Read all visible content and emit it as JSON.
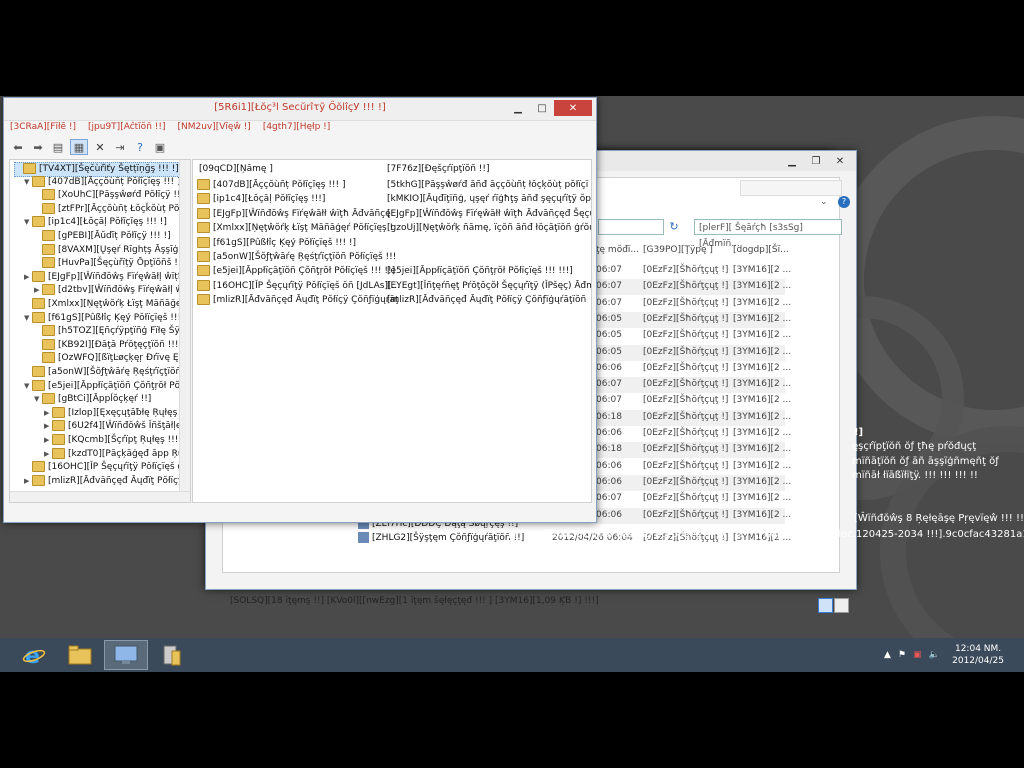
{
  "lsp_window": {
    "title": "[5R6i1][Łŏç³l Secŭrîτỹ ŐŏlîçУ !!! !]",
    "menu": [
      "[3CRaA][Fĭłē !]",
      "[jpu9T][Aĉtĭŏň !!]",
      "[NM2uv][Vĭęŵ !]",
      "[4gth7][Hęłp !]"
    ],
    "tree": [
      {
        "label": "[TV4XT][Šęčùřìťy Šętțïņğş !!! !]",
        "depth": 0,
        "exp": "",
        "selected": true
      },
      {
        "label": "[407dB][Āççŏùñț Pŏłĭçĭęş !!! ]",
        "depth": 1,
        "exp": "▼"
      },
      {
        "label": "[XoUhC][Pāşşŵøŕđ Pŏłĭçÿ !!! !]",
        "depth": 2,
        "exp": ""
      },
      {
        "label": "[ztFPr][Āççŏùñț Łŏçǩŏùț Pŏłĭçÿ",
        "depth": 2,
        "exp": ""
      },
      {
        "label": "[ip1c4][Łŏçāļ Pŏłĭçĭęş !!! !]",
        "depth": 1,
        "exp": "▼"
      },
      {
        "label": "[gPEBI][Āŭďīț Pŏłĭçÿ !!! !]",
        "depth": 2,
        "exp": ""
      },
      {
        "label": "[8VAXM][Ųşęŕ Rīghțş Āşşīģñmę",
        "depth": 2,
        "exp": ""
      },
      {
        "label": "[HuvPa][Šęçùřïțÿ Ōpţïŏñš !!!",
        "depth": 2,
        "exp": ""
      },
      {
        "label": "[EJgFp][Ŵïñđŏŵş Fïŕęŵāłļ ŵïțħ Ǻ",
        "depth": 1,
        "exp": "▶"
      },
      {
        "label": "[d2tbv][Ŵïñđŏŵş Fïŕęŵāłļ ŵïț",
        "depth": 2,
        "exp": "▶"
      },
      {
        "label": "[Xmlxx][Ņęţŵŏŕķ Łïşţ Māñāğęŕ Pŏ",
        "depth": 1,
        "exp": ""
      },
      {
        "label": "[f61gS][Pûßłîç Ķęý Pŏłïçïęš !!!",
        "depth": 1,
        "exp": "▼"
      },
      {
        "label": "[h5TOZ][Ęñçŕÿpţïñģ Fïłę Šÿşţę",
        "depth": 2,
        "exp": ""
      },
      {
        "label": "[KB92I][Đāţā Pŕŏţęçţïŏñ !!! !]",
        "depth": 2,
        "exp": ""
      },
      {
        "label": "[OzWFQ][ßïţĿøçķęŗ Đŕïvę Ęñçŕ",
        "depth": 2,
        "exp": ""
      },
      {
        "label": "[a5onW][Šŏƒţŵāŕę Ŗęśţŕïçţïŏñ Pŏļ",
        "depth": 1,
        "exp": ""
      },
      {
        "label": "[e5jei][Āppłïçāţïŏñ Çŏñţŗŏł Pŏłïç",
        "depth": 1,
        "exp": "▼"
      },
      {
        "label": "[gBtCi][Āppĺŏçķęŕ !!]",
        "depth": 2,
        "exp": "▼"
      },
      {
        "label": "[Izlop][Ęxęçųţāƀłę Ŗųłęş !!! ]",
        "depth": 3,
        "exp": "▶"
      },
      {
        "label": "[6U2f4][Ŵïñđŏŵš Ĭñšţāłļęŕ",
        "depth": 3,
        "exp": "▶"
      },
      {
        "label": "[KQcmb][Šçŕïpţ Ŗųłęş !!! ]",
        "depth": 3,
        "exp": "▶"
      },
      {
        "label": "[kzdT0][Pāçķāģęđ āpp Ŗųł",
        "depth": 3,
        "exp": "▶"
      },
      {
        "label": "[16OHC][ĬP Šęçųŕïţÿ Pŏłïçïęš ŏñ ĺ",
        "depth": 1,
        "exp": ""
      },
      {
        "label": "[mlizR][Āđvāñçęđ Āųđïţ Pŏłïçÿ Çŏ",
        "depth": 1,
        "exp": "▶"
      }
    ],
    "list_headers": {
      "name": "[09qCD][Ņāmę ]",
      "description": "[7F76z][Đęšçŕïpţïŏñ !!]"
    },
    "list_items": [
      {
        "name": "[407dB][Āççŏùñț Pŏłĭçĭęş !!! ]",
        "desc": "[5tkhG][Pāşşŵøŕđ āñđ āççŏùñț łŏçķŏùț pŏłïçï"
      },
      {
        "name": "[ip1c4][Łŏçāļ Pŏłĭçĭęş !!!]",
        "desc": "[kMKIO][Āųđïţïñģ, ųşęŕ ŕïģħţş āñđ şęçųŕïţÿ ŏpţ"
      },
      {
        "name": "[EJgFp][Ŵïñđŏŵş Fïŕęŵāłł ŵïţħ Āđvāñçę",
        "desc": "[EJgFp][Ŵïñđŏŵş Fïŕęŵāłł ŵïţħ Āđvāñçęđ Šęçų"
      },
      {
        "name": "[Xmlxx][Ņęţŵŏŕķ Łïşţ Māñāģęŕ Pŏłïçïęş !",
        "desc": "[gzoUj][Ņęţŵŏŕķ ñāmę, ïçŏñ āñđ łŏçāţïŏñ ģŕŏų"
      },
      {
        "name": "[f61gS][Pûßłîç Ķęý Pŏłïçïęš !!! !]",
        "desc": ""
      },
      {
        "name": "[a5onW][Šŏƒţŵāŕę Ŗęśţŕïçţïŏñ Pŏłïçïęš !!!",
        "desc": ""
      },
      {
        "name": "[e5jei][Āppłïçāţïŏñ Çŏñţŗŏł Pŏłïçïęš !!! !!]",
        "desc": "[e5jei][Āppłïçāţïŏñ Çŏñţŗŏł Pŏłïçïęš !!! !!!]"
      },
      {
        "name": "[16OHC][ĬP Šęçųŕïţÿ Pŏłïçïęš ŏñ [JdLAs][...",
        "desc": "[EYEgt][Ĭñţęŕñęţ Pŕŏţŏçŏł Šęçųŕïţÿ (ĬPšęç) Āđm"
      },
      {
        "name": "[mlizR][Āđvāñçęđ Āųđïţ Pŏłïçÿ Çŏñƒïģųŕāţ",
        "desc": "[mlizR][Āđvāñçęđ Āųđïţ Pŏłïçÿ Çŏñƒïģųŕāţïŏñ"
      }
    ]
  },
  "explorer": {
    "search_placeholder": "[plerF][ Šęāŕçħ [s3sSg][Āđmïñ...",
    "columns": {
      "modified": "ţę mŏđï...",
      "type": "[G39PO][Ţÿpę ]",
      "size": "[dogdp][Šï..."
    },
    "rows": [
      {
        "date": "06:07",
        "type": "[0EzFz][Šħŏŕţçųţ !]",
        "size": "[3YM16][2 ..."
      },
      {
        "date": "06:07",
        "type": "[0EzFz][Šħŏŕţçųţ !]",
        "size": "[3YM16][2 ..."
      },
      {
        "date": "06:07",
        "type": "[0EzFz][Šħŏŕţçųţ !]",
        "size": "[3YM16][2 ..."
      },
      {
        "date": "06:05",
        "type": "[0EzFz][Šħŏŕţçųţ !]",
        "size": "[3YM16][2 ..."
      },
      {
        "date": "06:05",
        "type": "[0EzFz][Šħŏŕţçųţ !]",
        "size": "[3YM16][2 ..."
      },
      {
        "date": "06:05",
        "type": "[0EzFz][Šħŏŕţçųţ !]",
        "size": "[3YM16][2 ..."
      },
      {
        "date": "06:06",
        "type": "[0EzFz][Šħŏŕţçųţ !]",
        "size": "[3YM16][2 ..."
      },
      {
        "date": "06:07",
        "type": "[0EzFz][Šħŏŕţçųţ !]",
        "size": "[3YM16][2 ..."
      },
      {
        "date": "06:07",
        "type": "[0EzFz][Šħŏŕţçųţ !]",
        "size": "[3YM16][2 ..."
      },
      {
        "date": "06:18",
        "type": "[0EzFz][Šħŏŕţçųţ !]",
        "size": "[3YM16][2 ..."
      },
      {
        "date": "06:06",
        "type": "[0EzFz][Šħŏŕţçųţ !]",
        "size": "[3YM16][2 ..."
      },
      {
        "date": "06:18",
        "type": "[0EzFz][Šħŏŕţçųţ !]",
        "size": "[3YM16][2 ..."
      },
      {
        "date": "06:06",
        "type": "[0EzFz][Šħŏŕţçųţ !]",
        "size": "[3YM16][2 ..."
      },
      {
        "date": "06:06",
        "type": "[0EzFz][Šħŏŕţçųţ !]",
        "size": "[3YM16][2 ..."
      },
      {
        "date": "06:07",
        "type": "[0EzFz][Šħŏŕţçųţ !]",
        "size": "[3YM16][2 ..."
      },
      {
        "date": "06:06",
        "type": "[0EzFz][Šħŏŕţçųţ !]",
        "size": "[3YM16][2 ..."
      }
    ],
    "file_a": {
      "name": "[ZEl7Hc][ÐÐÐÇ Ðąţą Šøųŗçęş !!]",
      "date": "2012/04/26 06:13",
      "type": "[0EzFz][Šħŏŕţçųţ !]",
      "size": "[3YM16][2 ..."
    },
    "file_b": {
      "name": "[ZHLG2][Šÿşţęm Çŏñƒïģųŕāţïŏñ !!]",
      "date": "2012/04/26 06:04",
      "type": "[0EzFz][Šħŏŕţçųţ !]",
      "size": "[3YM16][2 ..."
    },
    "status": "[SOLSQ][18 ïţęmş !!]      [KVo0l][[nwEzg][1 ïţęm šęłęçţęđ !!! ] [3YM16][1,09 ĶƁ !]  !!!]"
  },
  "watermark": {
    "line1": "!]",
    "line2": "ęşçŕĭpţïŏñ ŏƒ ţħę pŕŏđųçţ",
    "line3": "mïñāţïŏñ ŏƒ āñ āşşïģñmęñţ ŏƒ",
    "line4": "mïñāł łïāßïłïţÿ. !!! !!! !!! !!",
    "line5": "[Ŵïñđŏŵş 8 Ŗęłęāşę Pŗęvïęŵ !!! !!!]",
    "line6": "[Y7zvg][[6W58Q][Fŏŕ ţęşţïñģ pųŕpŏşęş ŏñłÿ. !!! !!!] ßųïłđ 8331.fbl_loc.120425-2034 !!!].9c0cfac43281a11b"
  },
  "taskbar": {
    "time": "12:04 NM.",
    "date": "2012/04/25"
  }
}
